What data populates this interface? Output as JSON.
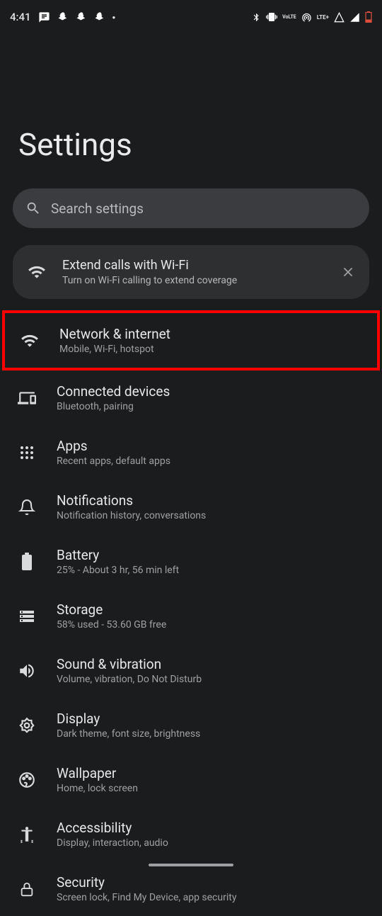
{
  "status": {
    "time": "4:41",
    "lte_label": "LTE+",
    "volte_label": "Vo",
    "volte_label2": "LTE"
  },
  "page": {
    "title": "Settings"
  },
  "search": {
    "placeholder": "Search settings"
  },
  "suggestion": {
    "title": "Extend calls with Wi-Fi",
    "subtitle": "Turn on Wi-Fi calling to extend coverage"
  },
  "items": [
    {
      "title": "Network & internet",
      "subtitle": "Mobile, Wi-Fi, hotspot"
    },
    {
      "title": "Connected devices",
      "subtitle": "Bluetooth, pairing"
    },
    {
      "title": "Apps",
      "subtitle": "Recent apps, default apps"
    },
    {
      "title": "Notifications",
      "subtitle": "Notification history, conversations"
    },
    {
      "title": "Battery",
      "subtitle": "25% - About 3 hr, 56 min left"
    },
    {
      "title": "Storage",
      "subtitle": "58% used - 53.60 GB free"
    },
    {
      "title": "Sound & vibration",
      "subtitle": "Volume, vibration, Do Not Disturb"
    },
    {
      "title": "Display",
      "subtitle": "Dark theme, font size, brightness"
    },
    {
      "title": "Wallpaper",
      "subtitle": "Home, lock screen"
    },
    {
      "title": "Accessibility",
      "subtitle": "Display, interaction, audio"
    },
    {
      "title": "Security",
      "subtitle": "Screen lock, Find My Device, app security"
    }
  ]
}
